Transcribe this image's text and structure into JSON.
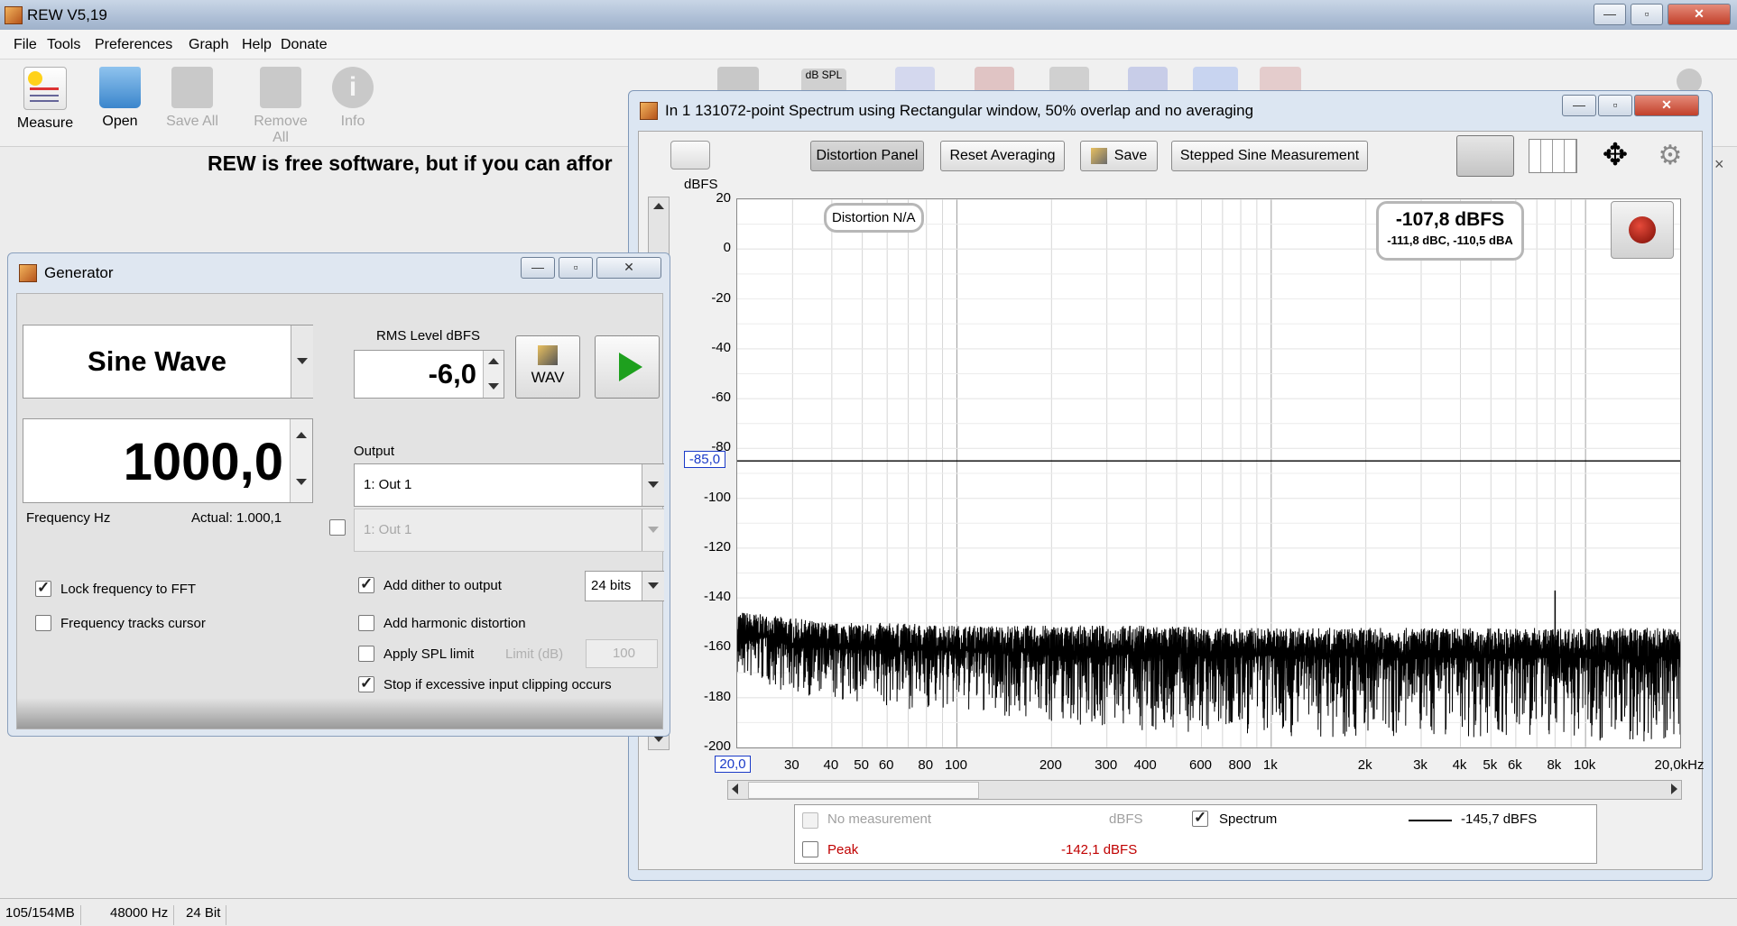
{
  "app": {
    "title": "REW V5,19"
  },
  "menu": [
    "File",
    "Tools",
    "Preferences",
    "Graph",
    "Help",
    "Donate"
  ],
  "toolbar": [
    {
      "label": "Measure",
      "enabled": true
    },
    {
      "label": "Open",
      "enabled": true
    },
    {
      "label": "Save All",
      "enabled": false
    },
    {
      "label": "Remove All",
      "enabled": false
    },
    {
      "label": "Info",
      "enabled": false
    }
  ],
  "banner": "REW is free software, but if you can affor",
  "generator": {
    "title": "Generator",
    "signal": "Sine Wave",
    "rms_label": "RMS Level dBFS",
    "rms_value": "-6,0",
    "wav_label": "WAV",
    "frequency": "1000,0",
    "freq_label": "Frequency Hz",
    "actual": "Actual: 1.000,1",
    "output_label": "Output",
    "output1": "1: Out 1",
    "output2": "1: Out 1",
    "lock_fft": "Lock frequency to FFT",
    "tracks_cursor": "Frequency tracks cursor",
    "add_dither": "Add dither to output",
    "bits": "24 bits",
    "add_harmonic": "Add harmonic distortion",
    "apply_spl": "Apply SPL limit",
    "limit_label": "Limit (dB)",
    "limit_value": "100",
    "stop_clip": "Stop if excessive input clipping occurs"
  },
  "spectrum": {
    "title": "In 1 131072-point Spectrum using Rectangular window, 50% overlap and no averaging",
    "buttons": [
      "Distortion Panel",
      "Reset Averaging",
      "Save",
      "Stepped Sine Measurement"
    ],
    "unit": "dBFS",
    "distortion_badge": "Distortion N/A",
    "readout_main": "-107,8 dBFS",
    "readout_sub": "-111,8 dBC, -110,5 dBA",
    "cursor_y": "-85,0",
    "cursor_x": "20,0",
    "legend": [
      {
        "name": "No measurement",
        "unit": "dBFS",
        "checked": false,
        "enabled": false
      },
      {
        "name": "Spectrum",
        "value": "-145,7 dBFS",
        "checked": true
      },
      {
        "name": "Peak",
        "value": "-142,1 dBFS",
        "checked": false,
        "color": "#c00000"
      }
    ]
  },
  "chart_data": {
    "type": "line",
    "ylabel": "dBFS",
    "ylim": [
      -200,
      20
    ],
    "yticks": [
      20,
      0,
      -20,
      -40,
      -60,
      -80,
      -100,
      -120,
      -140,
      -160,
      -180,
      -200
    ],
    "xlim": [
      20,
      20000
    ],
    "xscale": "log",
    "xticks": [
      {
        "v": 30,
        "l": "30"
      },
      {
        "v": 40,
        "l": "40"
      },
      {
        "v": 50,
        "l": "50"
      },
      {
        "v": 60,
        "l": "60"
      },
      {
        "v": 80,
        "l": "80"
      },
      {
        "v": 100,
        "l": "100"
      },
      {
        "v": 200,
        "l": "200"
      },
      {
        "v": 300,
        "l": "300"
      },
      {
        "v": 400,
        "l": "400"
      },
      {
        "v": 600,
        "l": "600"
      },
      {
        "v": 800,
        "l": "800"
      },
      {
        "v": 1000,
        "l": "1k"
      },
      {
        "v": 2000,
        "l": "2k"
      },
      {
        "v": 3000,
        "l": "3k"
      },
      {
        "v": 4000,
        "l": "4k"
      },
      {
        "v": 5000,
        "l": "5k"
      },
      {
        "v": 6000,
        "l": "6k"
      },
      {
        "v": 8000,
        "l": "8k"
      },
      {
        "v": 10000,
        "l": "10k"
      },
      {
        "v": 20000,
        "l": "20,0kHz"
      }
    ],
    "series": [
      {
        "name": "Spectrum",
        "x": [
          20,
          25,
          30,
          40,
          60,
          100,
          200,
          400,
          700,
          1000,
          2000,
          4000,
          8000,
          10000,
          15000,
          20000
        ],
        "y": [
          -158,
          -155,
          -160,
          -160,
          -161,
          -161,
          -162,
          -162,
          -163,
          -163,
          -163,
          -164,
          -164,
          -164,
          -164,
          -163
        ],
        "min": [
          -172,
          -176,
          -178,
          -182,
          -184,
          -186,
          -190,
          -194,
          -196,
          -196,
          -196,
          -196,
          -197,
          -197,
          -198,
          -197
        ],
        "max": [
          -145,
          -147,
          -148,
          -150,
          -150,
          -151,
          -151,
          -151,
          -152,
          -152,
          -152,
          -152,
          -152,
          -152,
          -152,
          -152
        ]
      }
    ],
    "peaks": [
      {
        "x": 8000,
        "y": -137
      }
    ],
    "cursor_level": -85
  },
  "status": [
    "105/154MB",
    "48000 Hz",
    "24 Bit"
  ]
}
